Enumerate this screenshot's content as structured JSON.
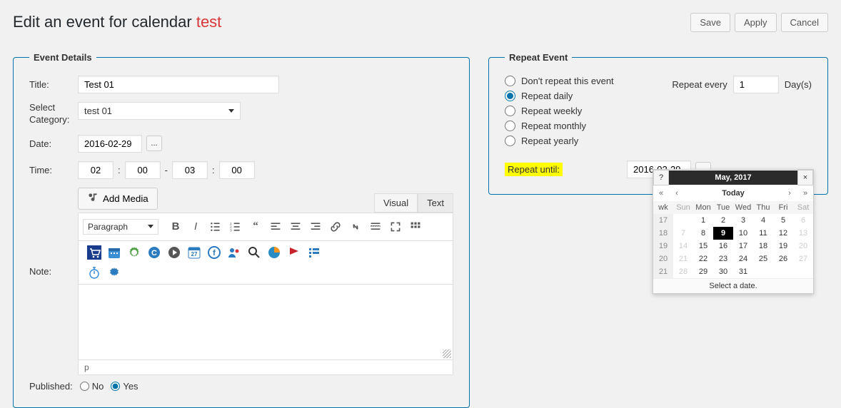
{
  "page_title_prefix": "Edit an event for calendar ",
  "page_title_suffix": "test",
  "buttons": {
    "save": "Save",
    "apply": "Apply",
    "cancel": "Cancel"
  },
  "event": {
    "legend": "Event Details",
    "labels": {
      "title": "Title:",
      "category": "Select Category:",
      "date": "Date:",
      "time": "Time:",
      "note": "Note:",
      "published": "Published:"
    },
    "title_value": "Test 01",
    "category_value": "test 01",
    "date_value": "2016-02-29",
    "time": {
      "h1": "02",
      "m1": "00",
      "h2": "03",
      "m2": "00",
      "colon": ":",
      "dash": "-"
    },
    "add_media": "Add Media",
    "tabs": {
      "visual": "Visual",
      "text": "Text"
    },
    "format_select": "Paragraph",
    "status_path": "p",
    "published": {
      "no": "No",
      "yes": "Yes",
      "value": "yes"
    }
  },
  "repeat": {
    "legend": "Repeat Event",
    "options": {
      "none": "Don't repeat this event",
      "daily": "Repeat daily",
      "weekly": "Repeat weekly",
      "monthly": "Repeat monthly",
      "yearly": "Repeat yearly"
    },
    "selected": "daily",
    "every_label": "Repeat every",
    "every_value": "1",
    "every_unit": "Day(s)",
    "until_label": "Repeat until:",
    "until_value": "2016-02-29"
  },
  "calendar": {
    "q": "?",
    "x": "×",
    "month": "May, 2017",
    "today": "Today",
    "dow": [
      "wk",
      "Sun",
      "Mon",
      "Tue",
      "Wed",
      "Thu",
      "Fri",
      "Sat"
    ],
    "weeks": [
      {
        "wk": "17",
        "days": [
          "",
          "1",
          "2",
          "3",
          "4",
          "5",
          "6"
        ],
        "muted": [
          6
        ]
      },
      {
        "wk": "18",
        "days": [
          "7",
          "8",
          "9",
          "10",
          "11",
          "12",
          "13"
        ],
        "sel": 2,
        "muted": [
          0,
          6
        ]
      },
      {
        "wk": "19",
        "days": [
          "14",
          "15",
          "16",
          "17",
          "18",
          "19",
          "20"
        ],
        "muted": [
          0,
          6
        ]
      },
      {
        "wk": "20",
        "days": [
          "21",
          "22",
          "23",
          "24",
          "25",
          "26",
          "27"
        ],
        "muted": [
          0,
          6
        ]
      },
      {
        "wk": "21",
        "days": [
          "28",
          "29",
          "30",
          "31",
          "",
          "",
          ""
        ],
        "muted": [
          0
        ]
      }
    ],
    "footer": "Select a date."
  }
}
